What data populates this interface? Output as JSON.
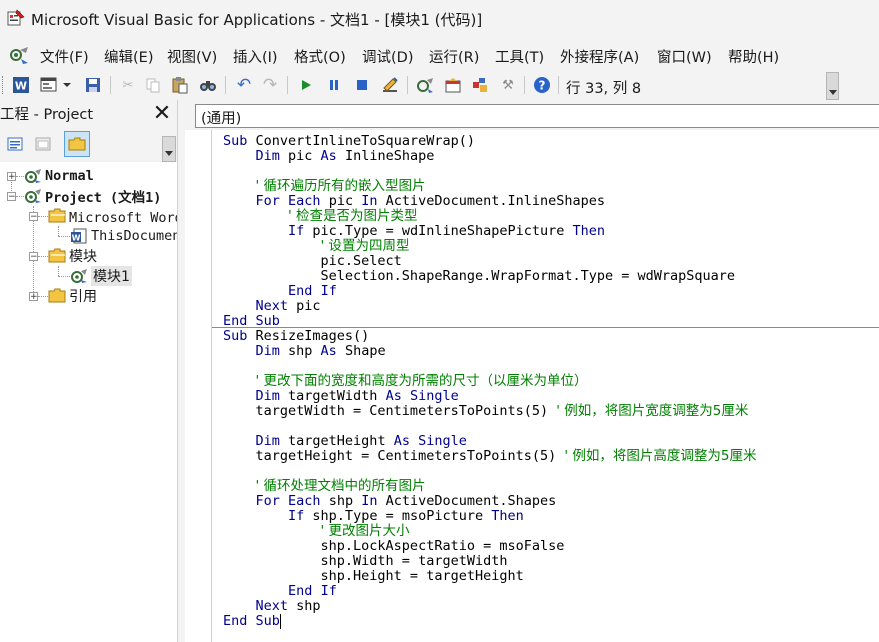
{
  "window": {
    "title": "Microsoft Visual Basic for Applications - 文档1 - [模块1 (代码)]"
  },
  "menu": [
    "文件(F)",
    "编辑(E)",
    "视图(V)",
    "插入(I)",
    "格式(O)",
    "调试(D)",
    "运行(R)",
    "工具(T)",
    "外接程序(A)",
    "窗口(W)",
    "帮助(H)"
  ],
  "toolbar": {
    "position_text": "行 33, 列 8"
  },
  "project": {
    "title": "工程 - Project",
    "tree": [
      {
        "label": "Normal",
        "icon": "vba-project-icon"
      },
      {
        "label": "Project (文档1)",
        "icon": "vba-project-icon"
      },
      {
        "label": "Microsoft Word 对象",
        "icon": "folder-icon"
      },
      {
        "label": "ThisDocument",
        "icon": "word-document-icon"
      },
      {
        "label": "模块",
        "icon": "folder-icon"
      },
      {
        "label": "模块1",
        "icon": "module-icon"
      },
      {
        "label": "引用",
        "icon": "folder-icon"
      }
    ]
  },
  "code": {
    "object_selector": "(通用)",
    "lines": [
      "Sub ConvertInlineToSquareWrap()",
      "    Dim pic As InlineShape",
      "",
      "    ' 循环遍历所有的嵌入型图片",
      "    For Each pic In ActiveDocument.InlineShapes",
      "        ' 检查是否为图片类型",
      "        If pic.Type = wdInlineShapePicture Then",
      "            ' 设置为四周型",
      "            pic.Select",
      "            Selection.ShapeRange.WrapFormat.Type = wdWrapSquare",
      "        End If",
      "    Next pic",
      "End Sub",
      "Sub ResizeImages()",
      "    Dim shp As Shape",
      "",
      "    ' 更改下面的宽度和高度为所需的尺寸（以厘米为单位）",
      "    Dim targetWidth As Single",
      "    targetWidth = CentimetersToPoints(5) ' 例如，将图片宽度调整为5厘米",
      "",
      "    Dim targetHeight As Single",
      "    targetHeight = CentimetersToPoints(5) ' 例如，将图片高度调整为5厘米",
      "",
      "    ' 循环处理文档中的所有图片",
      "    For Each shp In ActiveDocument.Shapes",
      "        If shp.Type = msoPicture Then",
      "            ' 更改图片大小",
      "            shp.LockAspectRatio = msoFalse",
      "            shp.Width = targetWidth",
      "            shp.Height = targetHeight",
      "        End If",
      "    Next shp",
      "End Sub"
    ]
  },
  "colors": {
    "keyword": "#00008b",
    "comment": "#008000",
    "text": "#000000"
  }
}
